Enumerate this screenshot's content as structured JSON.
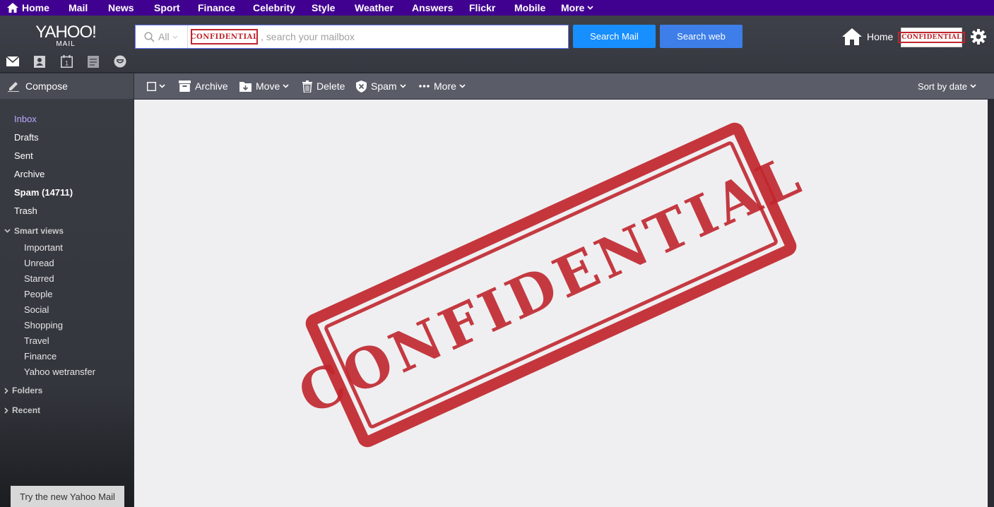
{
  "topnav": {
    "items": [
      "Home",
      "Mail",
      "News",
      "Sport",
      "Finance",
      "Celebrity",
      "Style",
      "Weather",
      "Answers",
      "Flickr",
      "Mobile",
      "More"
    ]
  },
  "header": {
    "logo_text": "YAHOO!",
    "logo_sub": "MAIL",
    "search_scope": "All",
    "search_stamp": "CONFIDENTIAL",
    "search_placeholder": ", search your mailbox",
    "search_mail_label": "Search Mail",
    "search_web_label": "Search web",
    "home_label": "Home",
    "avatar_stamp": "CONFIDENTIAL"
  },
  "compose": {
    "label": "Compose"
  },
  "toolbar": {
    "archive": "Archive",
    "move": "Move",
    "delete": "Delete",
    "spam": "Spam",
    "more": "More",
    "sort": "Sort by date"
  },
  "sidebar": {
    "folders": [
      "Inbox",
      "Drafts",
      "Sent",
      "Archive",
      "Spam (14711)",
      "Trash"
    ],
    "smart_views_label": "Smart views",
    "smart_views": [
      "Important",
      "Unread",
      "Starred",
      "People",
      "Social",
      "Shopping",
      "Travel",
      "Finance",
      "Yahoo wetransfer"
    ],
    "folders_label": "Folders",
    "recent_label": "Recent",
    "try_new": "Try the new Yahoo Mail"
  },
  "main": {
    "stamp_text": "CONFIDENTIAL"
  },
  "colors": {
    "topnav_bg": "#400090",
    "accent_blue": "#188fff",
    "stamp_red": "#c0262d",
    "active_folder": "#b9a9ff"
  }
}
